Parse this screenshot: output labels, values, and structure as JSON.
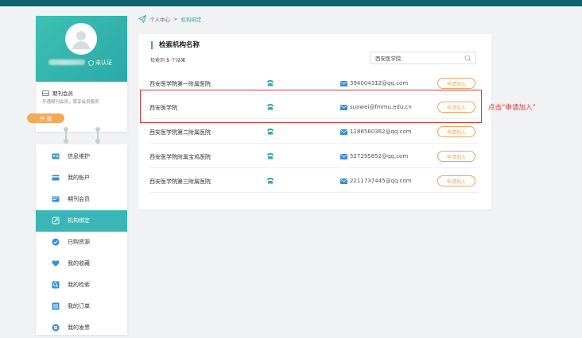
{
  "profile": {
    "verify_label": "未认证",
    "member_title": "期刊会员",
    "member_desc": "开通期刊会员，尊享会员服务",
    "open_button": "开 通"
  },
  "menu": {
    "items": [
      {
        "label": "信息维护",
        "icon": "id-card-icon"
      },
      {
        "label": "我的账户",
        "icon": "wallet-card-icon"
      },
      {
        "label": "期刊会员",
        "icon": "member-card-icon"
      },
      {
        "label": "机构绑定",
        "icon": "link-icon",
        "active": true
      },
      {
        "label": "已购资源",
        "icon": "check-circle-icon"
      },
      {
        "label": "我的收藏",
        "icon": "heart-icon"
      },
      {
        "label": "我的检索",
        "icon": "search-square-icon"
      },
      {
        "label": "我的订单",
        "icon": "order-list-icon"
      },
      {
        "label": "我的发票",
        "icon": "invoice-icon"
      }
    ]
  },
  "breadcrumb": {
    "parent": "个人中心",
    "separator": ">",
    "current": "机构绑定"
  },
  "panel": {
    "title": "检索机构名称",
    "count_prefix": "检索到",
    "count": "5",
    "count_suffix": "个结果",
    "search_value": "西安医学院",
    "apply_label": "申请加入"
  },
  "institutions": [
    {
      "name": "西安医学院第一附属医院",
      "email": "394004312@qq.com"
    },
    {
      "name": "西安医学院",
      "email": "suowei@fmmu.edu.cn"
    },
    {
      "name": "西安医学院第二附属医院",
      "email": "1186560362@qq.com"
    },
    {
      "name": "西安医学院附属宝鸡医院",
      "email": "527295852@qq.com"
    },
    {
      "name": "西安医学院第三附属医院",
      "email": "2211737445@qq.com"
    }
  ],
  "annotation": "点击“申请加入”",
  "colors": {
    "accent": "#3ab6b6",
    "topbar": "#0f6472",
    "apply": "#f1a35f",
    "highlight": "#e03a34"
  }
}
